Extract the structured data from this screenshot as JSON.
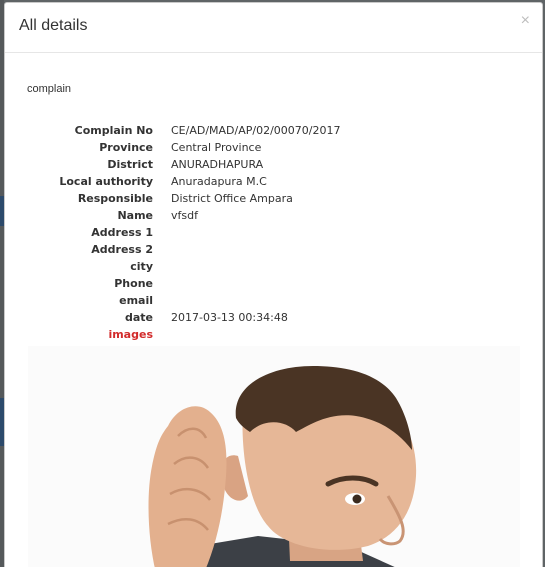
{
  "modal": {
    "title": "All details",
    "close_symbol": "×",
    "section_label": "complain"
  },
  "details": [
    {
      "label": "Complain No",
      "value": "CE/AD/MAD/AP/02/00070/2017"
    },
    {
      "label": "Province",
      "value": "Central Province"
    },
    {
      "label": "District",
      "value": "ANURADHAPURA"
    },
    {
      "label": "Local authority",
      "value": "Anuradapura M.C"
    },
    {
      "label": "Responsible",
      "value": "District Office Ampara"
    },
    {
      "label": "Name",
      "value": "vfsdf"
    },
    {
      "label": "Address 1",
      "value": ""
    },
    {
      "label": "Address 2",
      "value": ""
    },
    {
      "label": "city",
      "value": ""
    },
    {
      "label": "Phone",
      "value": ""
    },
    {
      "label": "email",
      "value": ""
    },
    {
      "label": "date",
      "value": "2017-03-13 00:34:48"
    },
    {
      "label": "images",
      "value": ""
    }
  ],
  "colors": {
    "images_label": "#d22b2b",
    "overlay": "#5f6466"
  },
  "image": {
    "icon": "photo-man-listening"
  }
}
